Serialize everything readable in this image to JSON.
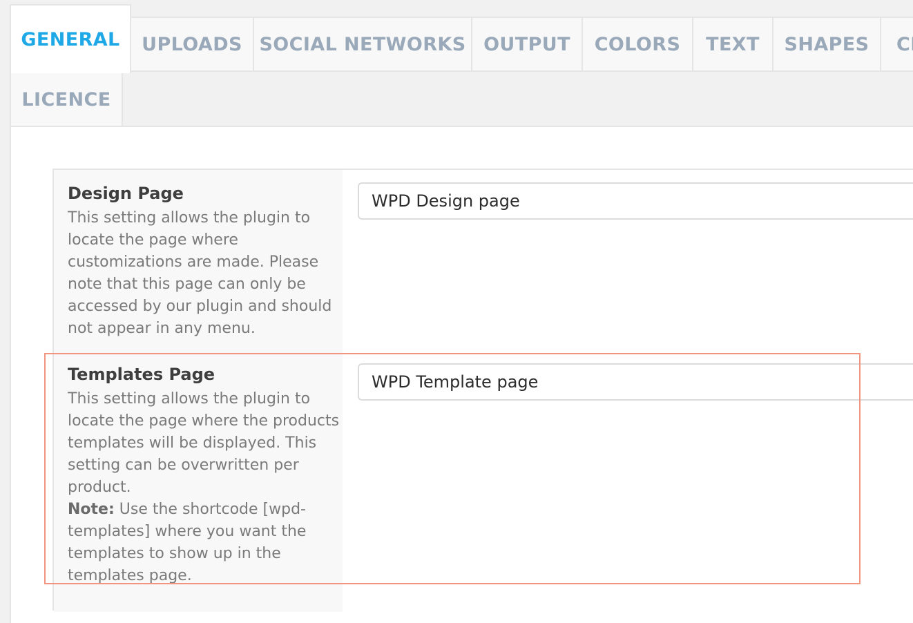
{
  "tabs": [
    {
      "label": "GENERAL",
      "active": true
    },
    {
      "label": "UPLOADS",
      "active": false
    },
    {
      "label": "SOCIAL NETWORKS",
      "active": false
    },
    {
      "label": "OUTPUT",
      "active": false
    },
    {
      "label": "COLORS",
      "active": false
    },
    {
      "label": "TEXT",
      "active": false
    },
    {
      "label": "SHAPES",
      "active": false
    },
    {
      "label": "CL",
      "active": false
    },
    {
      "label": "LICENCE",
      "active": false
    }
  ],
  "settings": {
    "design_page": {
      "title": "Design Page",
      "description": "This setting allows the plugin to locate the page where customizations are made. Please note that this page can only be accessed by our plugin and should not appear in any menu.",
      "value": "WPD Design page"
    },
    "templates_page": {
      "title": "Templates Page",
      "description": "This setting allows the plugin to locate the page where the products templates will be displayed. This setting can be overwritten per product.",
      "note_label": "Note:",
      "note_text": " Use the shortcode [wpd-templates] where you want the templates to show up in the templates page.",
      "value": "WPD Template page"
    }
  },
  "colors": {
    "active_tab": "#1fa8e6",
    "inactive_tab": "#9aa9b9",
    "highlight": "#f2947f"
  }
}
